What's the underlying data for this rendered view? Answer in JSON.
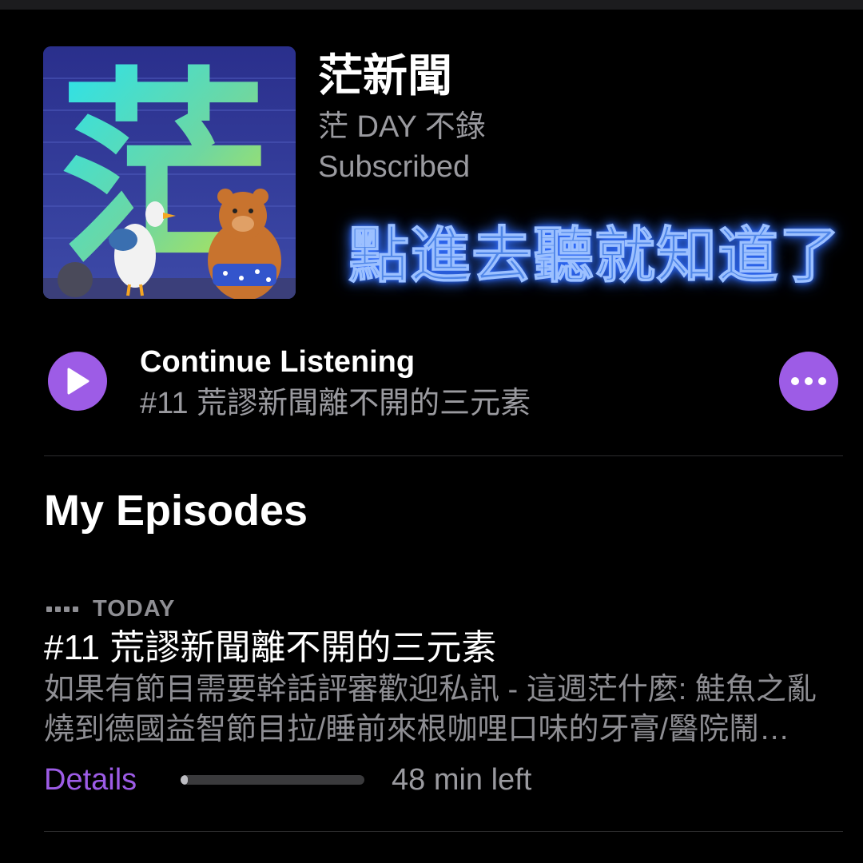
{
  "podcast": {
    "title": "茫新聞",
    "author": "茫 DAY 不錄",
    "status": "Subscribed",
    "artwork_glyph": "茫"
  },
  "overlay_caption": "點進去聽就知道了",
  "continue": {
    "label": "Continue Listening",
    "episode_title": "#11 荒謬新聞離不開的三元素",
    "play_icon": "play-icon",
    "more_icon": "ellipsis-icon"
  },
  "my_episodes": {
    "section_title": "My Episodes",
    "episodes": [
      {
        "date": "TODAY",
        "title": "#11 荒謬新聞離不開的三元素",
        "description": "如果有節目需要幹話評審歡迎私訊 - 這週茫什麼: 鮭魚之亂燒到德國益智節目拉/睡前來根咖哩口味的牙膏/醫院鬧…",
        "details_label": "Details",
        "progress_fraction": 0.03,
        "time_left": "48 min left"
      }
    ]
  },
  "colors": {
    "accent": "#9d5ce6",
    "background": "#000000",
    "secondary_text": "#9a9a9f",
    "caption_glow": "#2f6cff"
  }
}
